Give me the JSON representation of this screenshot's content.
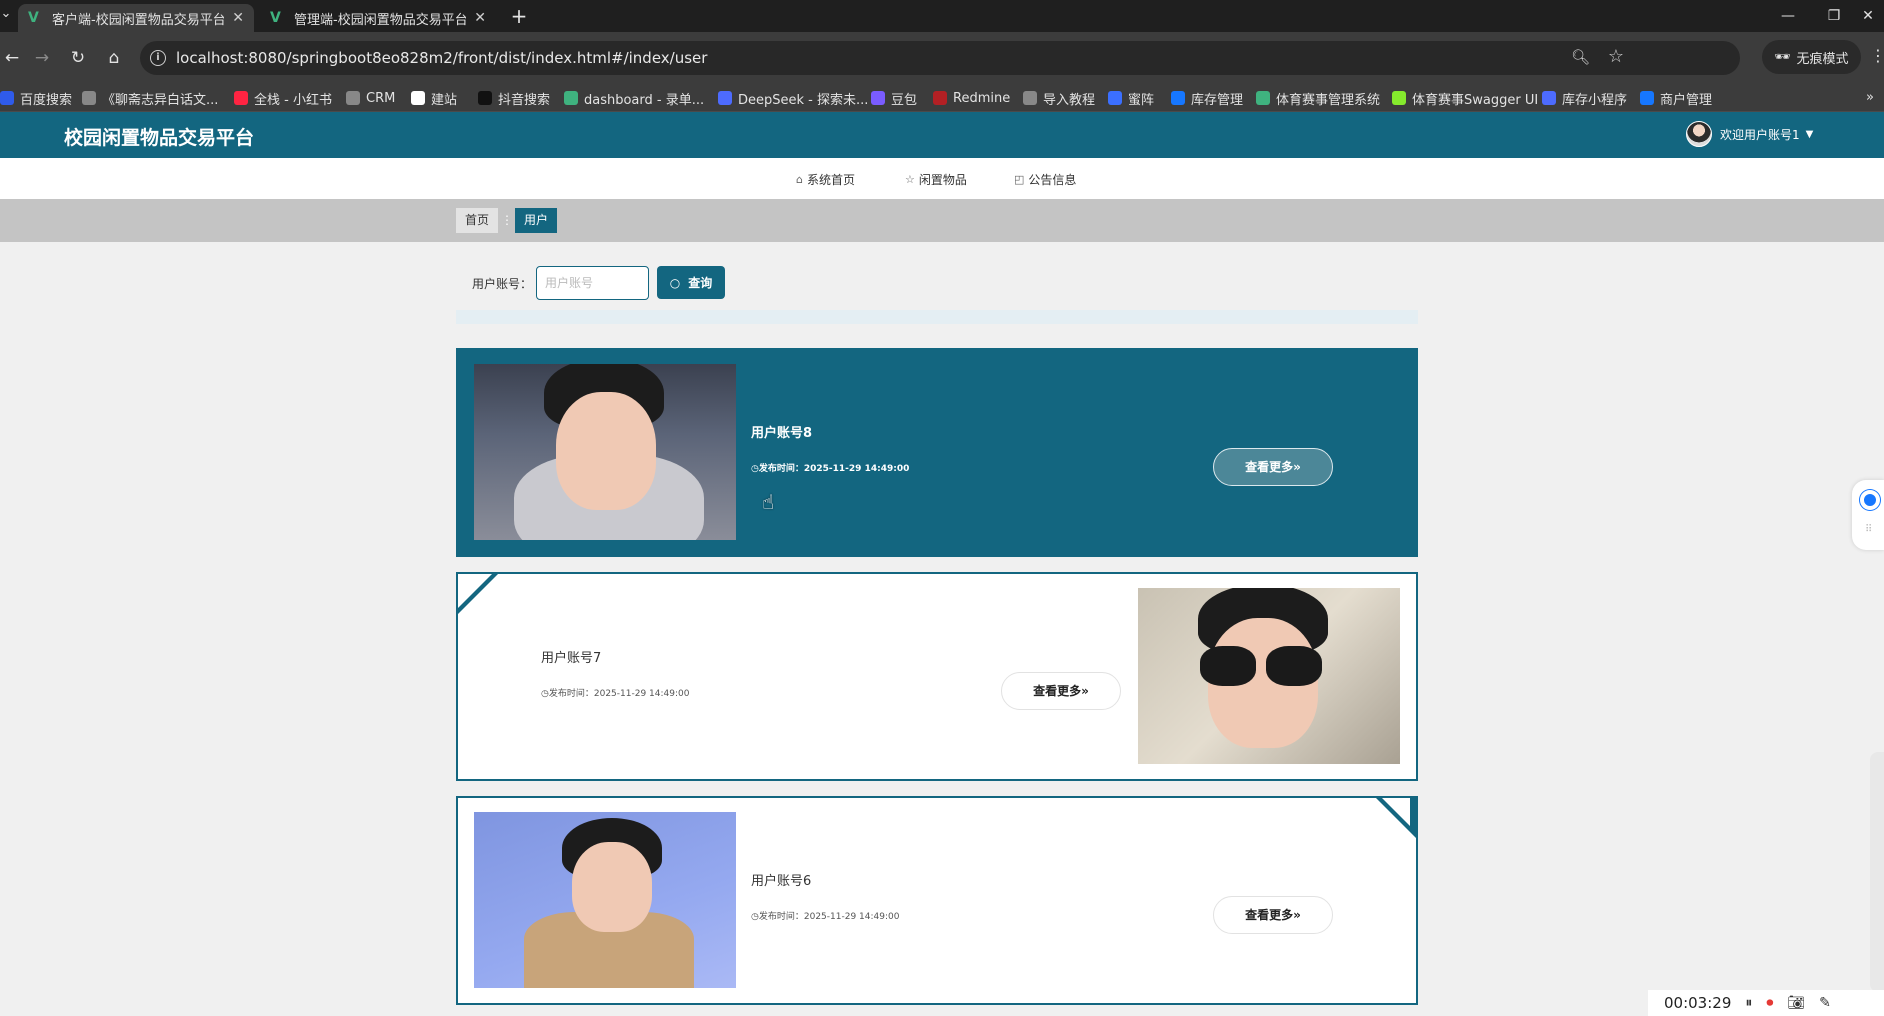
{
  "browser": {
    "tabs": [
      {
        "title": "客户端-校园闲置物品交易平台",
        "active": true
      },
      {
        "title": "管理端-校园闲置物品交易平台",
        "active": false
      }
    ],
    "url": "localhost:8080/springboot8eo828m2/front/dist/index.html#/index/user",
    "incognito_label": "无痕模式",
    "bookmarks": [
      {
        "label": "百度搜索",
        "icon": "baidu-icon",
        "color": "#2f5bea"
      },
      {
        "label": "《聊斋志异白话文...",
        "icon": "globe-icon",
        "color": "#888888"
      },
      {
        "label": "全栈 - 小红书",
        "icon": "xiaohongshu-icon",
        "color": "#ff2442"
      },
      {
        "label": "CRM",
        "icon": "globe-icon",
        "color": "#888888"
      },
      {
        "label": "建站",
        "icon": "build-icon",
        "color": "#ffffff"
      },
      {
        "label": "抖音搜索",
        "icon": "douyin-icon",
        "color": "#111111"
      },
      {
        "label": "dashboard - 录单...",
        "icon": "dashboard-icon",
        "color": "#3fb27f"
      },
      {
        "label": "DeepSeek - 探索未...",
        "icon": "deepseek-icon",
        "color": "#4d6bfe"
      },
      {
        "label": "豆包",
        "icon": "doubao-icon",
        "color": "#7a5cff"
      },
      {
        "label": "Redmine",
        "icon": "redmine-icon",
        "color": "#b32024"
      },
      {
        "label": "导入教程",
        "icon": "globe-icon",
        "color": "#888888"
      },
      {
        "label": "蜜阵",
        "icon": "shield-icon",
        "color": "#3b6fff"
      },
      {
        "label": "库存管理",
        "icon": "app-icon",
        "color": "#1677ff"
      },
      {
        "label": "体育赛事管理系统",
        "icon": "dashboard-icon",
        "color": "#3fb27f"
      },
      {
        "label": "体育赛事Swagger UI",
        "icon": "swagger-icon",
        "color": "#85ea2d"
      },
      {
        "label": "库存小程序",
        "icon": "mountain-icon",
        "color": "#4d6bfe"
      },
      {
        "label": "商户管理",
        "icon": "app-icon",
        "color": "#1677ff"
      }
    ]
  },
  "site": {
    "title": "校园闲置物品交易平台",
    "user_greeting": "欢迎用户账号1",
    "nav": [
      {
        "label": "系统首页",
        "icon": "home-icon"
      },
      {
        "label": "闲置物品",
        "icon": "star-icon"
      },
      {
        "label": "公告信息",
        "icon": "bag-icon"
      }
    ],
    "breadcrumb": {
      "home": "首页",
      "separator": "⋮",
      "current": "用户"
    },
    "search": {
      "label": "用户账号：",
      "placeholder": "用户账号",
      "button": "查询"
    },
    "time_prefix": "发布时间：",
    "more_label": "查看更多»",
    "users": [
      {
        "name": "用户账号8",
        "time": "2025-11-29 14:49:00"
      },
      {
        "name": "用户账号7",
        "time": "2025-11-29 14:49:00"
      },
      {
        "name": "用户账号6",
        "time": "2025-11-29 14:49:00"
      }
    ]
  },
  "recorder": {
    "time": "00:03:29"
  },
  "colors": {
    "primary": "#136680",
    "band": "#c4c4c4",
    "page_bg": "#f0f0f0"
  }
}
